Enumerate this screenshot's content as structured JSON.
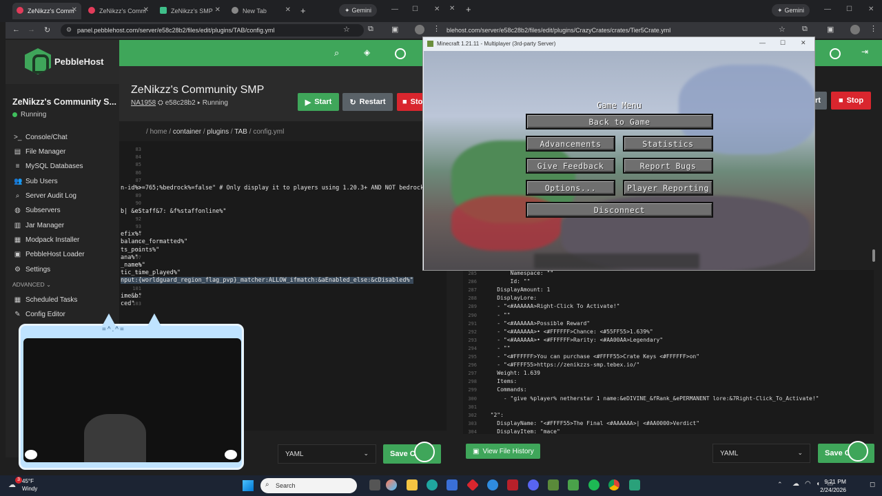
{
  "browser": {
    "tabs": [
      {
        "label": "ZeNikzz's Comm"
      },
      {
        "label": "ZeNikzz's Comm"
      },
      {
        "label": "ZeNikzz's SMP"
      },
      {
        "label": "New Tab"
      }
    ],
    "gemini_label": "Gemini",
    "url_left": "panel.pebblehost.com/server/e58c28b2/files/edit/plugins/TAB/config.yml",
    "url_right": "blehost.com/server/e58c28b2/files/edit/plugins/CrazyCrates/crates/Tier5Crate.yml"
  },
  "panel": {
    "brand": "PebbleHost",
    "server_name": "ZeNikzz's Community S...",
    "server_status": "Running",
    "nav": [
      {
        "label": "Console/Chat",
        "icon": "terminal-icon"
      },
      {
        "label": "File Manager",
        "icon": "file-icon"
      },
      {
        "label": "MySQL Databases",
        "icon": "database-icon"
      },
      {
        "label": "Sub Users",
        "icon": "users-icon"
      },
      {
        "label": "Server Audit Log",
        "icon": "search-icon"
      },
      {
        "label": "Subservers",
        "icon": "globe-icon"
      },
      {
        "label": "Jar Manager",
        "icon": "jar-icon"
      },
      {
        "label": "Modpack Installer",
        "icon": "package-icon"
      },
      {
        "label": "PebbleHost Loader",
        "icon": "loader-icon"
      },
      {
        "label": "Settings",
        "icon": "gear-icon"
      }
    ],
    "advanced_label": "ADVANCED",
    "advanced_nav": [
      {
        "label": "Scheduled Tasks",
        "icon": "calendar-icon"
      },
      {
        "label": "Config Editor",
        "icon": "edit-icon"
      }
    ],
    "header_title": "ZeNikzz's Community SMP",
    "header_node": "NA1958",
    "header_id": "e58c28b2",
    "header_status": "Running",
    "btn_start": "Start",
    "btn_restart": "Restart",
    "btn_stop": "Sto",
    "btn_stop_right": "Stop",
    "btn_restart_right": "rt",
    "breadcrumb": [
      "home",
      "container",
      "plugins",
      "TAB",
      "config.yml"
    ],
    "file_type": "YAML",
    "save_label": "Save C",
    "history_label": "View File History"
  },
  "editor_left": {
    "lines": [
      {
        "n": "83",
        "t": ""
      },
      {
        "n": "84",
        "t": ""
      },
      {
        "n": "85",
        "t": ""
      },
      {
        "n": "86",
        "t": ""
      },
      {
        "n": "87",
        "t": ""
      },
      {
        "n": "88",
        "t": "n-id%>=765;%bedrock%=false\" # Only display it to players using 1.20.3+ AND NOT bedrock e"
      },
      {
        "n": "89",
        "t": ""
      },
      {
        "n": "90",
        "t": ""
      },
      {
        "n": "91",
        "t": "b| &eStaff&7: &f%staffonline%\""
      },
      {
        "n": "92",
        "t": ""
      },
      {
        "n": "93",
        "t": ""
      },
      {
        "n": "94",
        "t": "efix%\""
      },
      {
        "n": "95",
        "t": "balance_formatted%\""
      },
      {
        "n": "96",
        "t": "ts_points%\""
      },
      {
        "n": "97",
        "t": "ana%\""
      },
      {
        "n": "98",
        "t": "_name%\""
      },
      {
        "n": "99",
        "t": "tic_time_played%\""
      },
      {
        "n": "100",
        "t": "nput:{worldguard_region_flag_pvp}_matcher:ALLOW_ifmatch:&aEnabled_else:&cDisabled%\""
      },
      {
        "n": "101",
        "t": ""
      },
      {
        "n": "102",
        "t": "ime&b\""
      },
      {
        "n": "103",
        "t": "ced\""
      }
    ]
  },
  "editor_right": {
    "lines": [
      {
        "n": "285",
        "t": "        Namespace: \"\""
      },
      {
        "n": "286",
        "t": "        Id: \"\""
      },
      {
        "n": "287",
        "t": "    DisplayAmount: 1"
      },
      {
        "n": "288",
        "t": "    DisplayLore:"
      },
      {
        "n": "289",
        "t": "    - \"<#AAAAAA>Right-Click To Activate!\""
      },
      {
        "n": "290",
        "t": "    - \"\""
      },
      {
        "n": "291",
        "t": "    - \"<#AAAAAA>Possible Reward\""
      },
      {
        "n": "292",
        "t": "    - \"<#AAAAAA>• <#FFFFFF>Chance: <#55FF55>1.639%\""
      },
      {
        "n": "293",
        "t": "    - \"<#AAAAAA>• <#FFFFFF>Rarity: <#AA00AA>Legendary\""
      },
      {
        "n": "294",
        "t": "    - \"\""
      },
      {
        "n": "295",
        "t": "    - \"<#FFFFFF>You can purchase <#FFFF55>Crate Keys <#FFFFFF>on\""
      },
      {
        "n": "296",
        "t": "    - \"<#FFFF55>https://zenikzzs-smp.tebex.io/\""
      },
      {
        "n": "297",
        "t": "    Weight: 1.639"
      },
      {
        "n": "298",
        "t": "    Items:"
      },
      {
        "n": "299",
        "t": "    Commands:"
      },
      {
        "n": "300",
        "t": "      - \"give %player% netherstar 1 name:&eDIVINE_&fRank_&ePERMANENT lore:&7Right-Click_To_Activate!\""
      },
      {
        "n": "301",
        "t": ""
      },
      {
        "n": "302",
        "t": "  \"2\":"
      },
      {
        "n": "303",
        "t": "    DisplayName: \"<#FFFF55>The Final <#AAAAAA>| <#AA0000>Verdict\""
      },
      {
        "n": "304",
        "t": "    DisplayItem: \"mace\""
      }
    ]
  },
  "minecraft": {
    "window_title": "Minecraft 1.21.11 - Multiplayer (3rd-party Server)",
    "menu_title": "Game Menu",
    "back_to_game": "Back to Game",
    "advancements": "Advancements",
    "statistics": "Statistics",
    "give_feedback": "Give Feedback",
    "report_bugs": "Report Bugs",
    "options": "Options...",
    "player_reporting": "Player Reporting",
    "disconnect": "Disconnect"
  },
  "taskbar": {
    "temp": "45°F",
    "weather": "Windy",
    "search": "Search",
    "time": "9:21 PM",
    "date": "2/24/2026",
    "notification_count": "3"
  },
  "colors": {
    "accent": "#3fa65a",
    "restart": "#5a6268",
    "stop": "#d9262e"
  }
}
